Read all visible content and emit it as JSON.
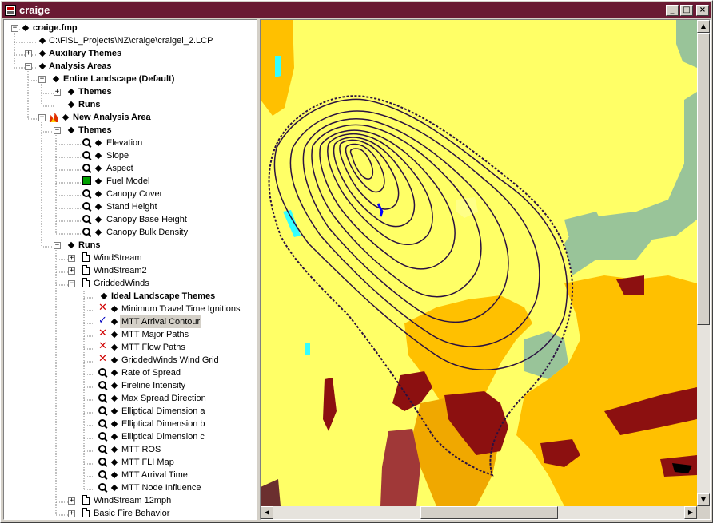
{
  "window": {
    "title": "craige",
    "buttons": {
      "minimize": "_",
      "maximize": "□",
      "close": "×"
    }
  },
  "tree": {
    "root_label": "craige.fmp",
    "lcp_path": "C:\\FiSL_Projects\\NZ\\craige\\craigei_2.LCP",
    "auxiliary_themes": "Auxiliary Themes",
    "analysis_areas": "Analysis Areas",
    "entire_landscape": "Entire Landscape (Default)",
    "entire_themes": "Themes",
    "entire_runs": "Runs",
    "new_analysis_area": "New Analysis Area",
    "new_themes": "Themes",
    "themes": [
      "Elevation",
      "Slope",
      "Aspect",
      "Fuel Model",
      "Canopy Cover",
      "Stand Height",
      "Canopy Base Height",
      "Canopy Bulk Density"
    ],
    "runs_label": "Runs",
    "runs": [
      "WindStream",
      "WindStream2",
      "GriddedWinds"
    ],
    "ideal_label": "Ideal Landscape Themes",
    "gridded_outputs": [
      {
        "label": "Minimum Travel Time Ignitions",
        "icon": "x-icon"
      },
      {
        "label": "MTT Arrival Contour",
        "icon": "check-icon",
        "selected": true
      },
      {
        "label": "MTT Major Paths",
        "icon": "x-icon"
      },
      {
        "label": "MTT Flow Paths",
        "icon": "x-icon"
      },
      {
        "label": "GriddedWinds Wind Grid",
        "icon": "x-icon"
      },
      {
        "label": "Rate of Spread",
        "icon": "magnifier-icon"
      },
      {
        "label": "Fireline Intensity",
        "icon": "magnifier-icon"
      },
      {
        "label": "Max Spread Direction",
        "icon": "magnifier-icon"
      },
      {
        "label": "Elliptical Dimension a",
        "icon": "magnifier-icon"
      },
      {
        "label": "Elliptical Dimension b",
        "icon": "magnifier-icon"
      },
      {
        "label": "Elliptical Dimension c",
        "icon": "magnifier-icon"
      },
      {
        "label": "MTT ROS",
        "icon": "magnifier-icon"
      },
      {
        "label": "MTT FLI Map",
        "icon": "magnifier-icon"
      },
      {
        "label": "MTT Arrival Time",
        "icon": "magnifier-icon"
      },
      {
        "label": "MTT Node Influence",
        "icon": "magnifier-icon"
      }
    ],
    "more_runs": [
      "WindStream 12mph",
      "Basic Fire Behavior"
    ]
  },
  "map": {
    "colors": {
      "background": "#ffff66",
      "light_yellow": "#ffff88",
      "orange": "#ffc000",
      "dark_orange": "#f0a800",
      "sage": "#99c499",
      "maroon": "#8c1010",
      "brown_red": "#a03838",
      "cyan": "#33ffff",
      "contour": "#2a1040"
    }
  }
}
